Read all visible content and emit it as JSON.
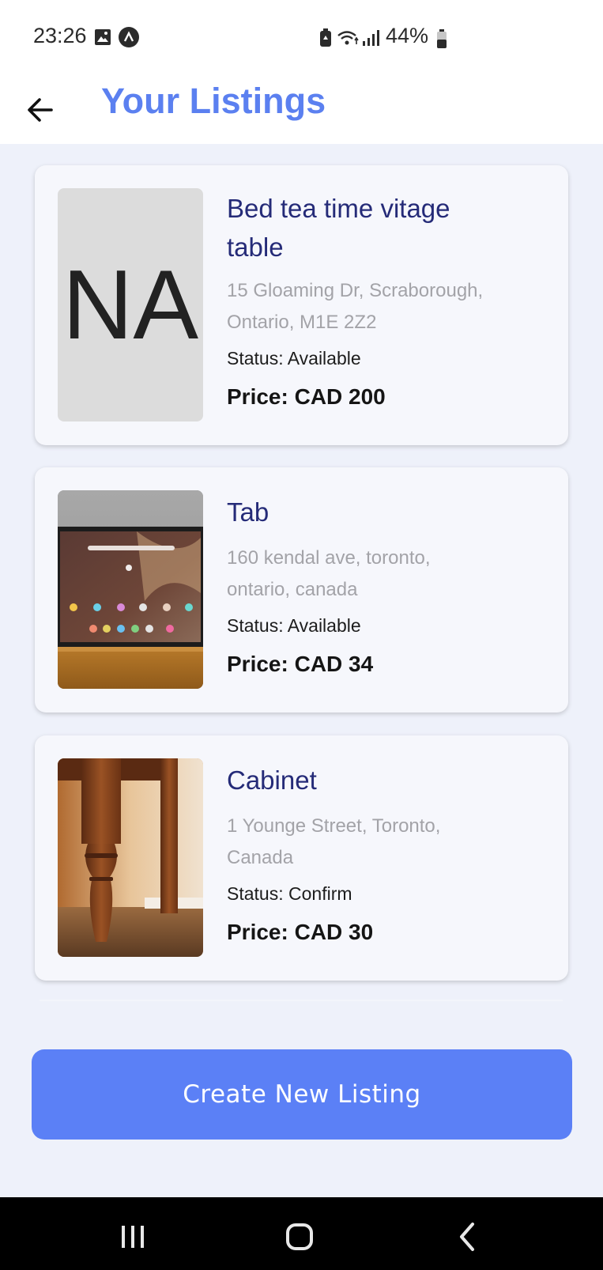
{
  "status_bar": {
    "time": "23:26",
    "battery": "44%",
    "icons": [
      "image-icon",
      "app-notification-icon",
      "battery-saver-icon",
      "wifi-icon",
      "signal-icon",
      "battery-icon"
    ]
  },
  "header": {
    "back_icon": "arrow-left-icon",
    "title": "Your Listings",
    "title_color": "#5b80f0"
  },
  "listings": [
    {
      "title_line1": "Bed tea time vitage",
      "title_line2": "table",
      "address_line1": "15 Gloaming Dr, Scraborough,",
      "address_line2": "Ontario, M1E 2Z2",
      "status_label": "Status:",
      "status_value": "Available",
      "price": "Price: CAD 200",
      "image_placeholder": "NA"
    },
    {
      "title_line1": "Tab",
      "address_line1": "160 kendal ave, toronto,",
      "address_line2": "ontario, canada",
      "status_label": "Status:",
      "status_value": "Available",
      "price": "Price: CAD 34",
      "image": "tablet-photo"
    },
    {
      "title_line1": "Cabinet",
      "address_line1": "1 Younge Street, Toronto,",
      "address_line2": "Canada",
      "status_label": "Status:",
      "status_value": "Confirm",
      "price": "Price: CAD 30",
      "image": "cabinet-leg-photo"
    }
  ],
  "create_button": {
    "label": "Create New Listing",
    "color": "#5b80f6"
  },
  "nav_bar": {
    "icons": [
      "recent-apps-icon",
      "home-icon",
      "back-icon"
    ]
  },
  "colors": {
    "background": "#eef1fa",
    "card": "#f6f7fc",
    "listing_title": "#252b78",
    "address": "#a3a3a8"
  }
}
